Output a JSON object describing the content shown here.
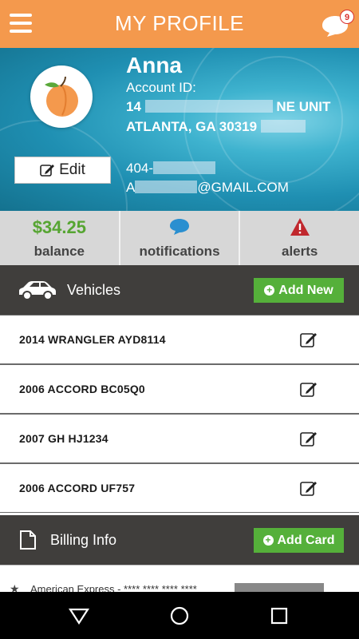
{
  "header": {
    "title": "MY PROFILE",
    "notification_count": "9"
  },
  "profile": {
    "name": "Anna",
    "account_id_label": "Account ID:",
    "address_prefix": "14",
    "address_suffix": "NE UNIT",
    "city_line": "ATLANTA, GA 30319",
    "phone_prefix": "404-",
    "email_prefix": "A",
    "email_suffix": "@GMAIL.COM",
    "edit_label": "Edit"
  },
  "stats": {
    "balance_value": "$34.25",
    "balance_label": "balance",
    "notifications_label": "notifications",
    "alerts_label": "alerts"
  },
  "vehicles": {
    "title": "Vehicles",
    "add_label": "Add New",
    "items": [
      "2014 WRANGLER AYD8114",
      "2006 ACCORD BC05Q0",
      "2007 GH HJ1234",
      "2006 ACCORD UF757"
    ]
  },
  "billing": {
    "title": "Billing Info",
    "add_label": "Add Card",
    "card_text": "American Express - **** **** **** ****"
  },
  "colors": {
    "accent_orange": "#f4994d",
    "green": "#55b03a",
    "dark_section": "#403e3c",
    "header_teal": "#1f8fb2",
    "alert_red": "#c0272d",
    "notification_blue": "#2a8fd0"
  },
  "icons": {
    "menu": "hamburger-icon",
    "chat": "chat-bubble-icon",
    "car": "car-icon",
    "document": "document-icon",
    "edit": "pencil-square-icon",
    "alert": "warning-triangle-icon",
    "notification": "speech-bubble-icon"
  }
}
